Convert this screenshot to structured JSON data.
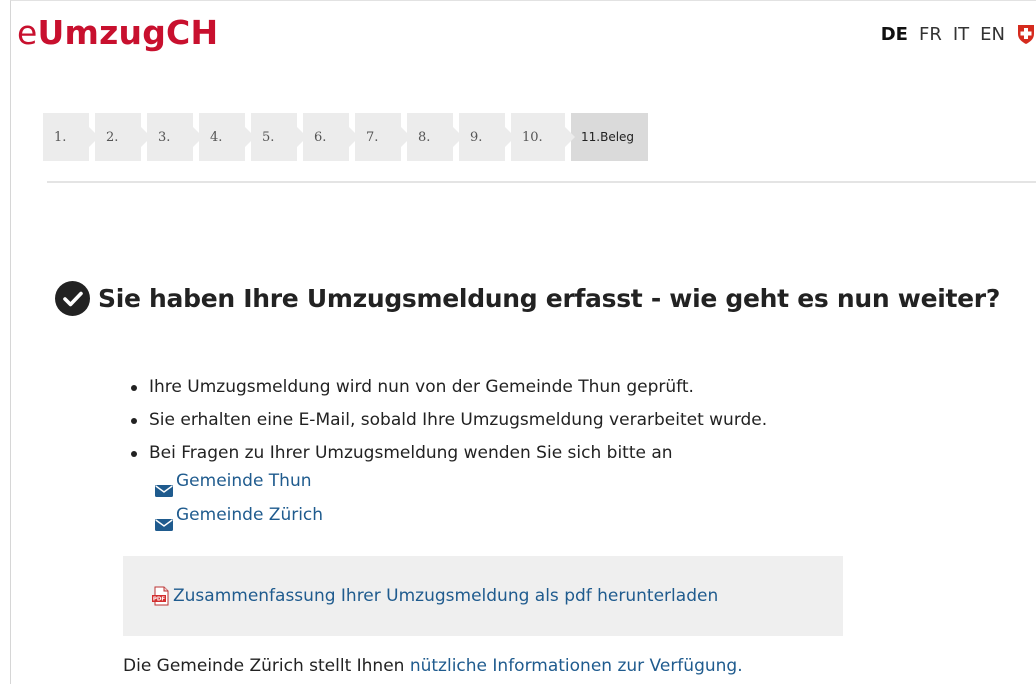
{
  "brand": {
    "prefix": "e",
    "name": "UmzugCH"
  },
  "languages": {
    "de": "DE",
    "fr": "FR",
    "it": "IT",
    "en": "EN",
    "active": "DE",
    "flag_icon": "swiss-cross-icon"
  },
  "steps": [
    {
      "label": "1."
    },
    {
      "label": "2."
    },
    {
      "label": "3."
    },
    {
      "label": "4."
    },
    {
      "label": "5."
    },
    {
      "label": "6."
    },
    {
      "label": "7."
    },
    {
      "label": "8."
    },
    {
      "label": "9."
    },
    {
      "label": "10."
    },
    {
      "label": "11.Beleg",
      "active": true
    }
  ],
  "heading": {
    "icon": "check-circle-icon",
    "text": "Sie haben Ihre Umzugsmeldung erfasst - wie geht es nun weiter?"
  },
  "info": {
    "items": [
      "Ihre Umzugsmeldung wird nun von der Gemeinde Thun geprüft.",
      "Sie erhalten eine E-Mail, sobald Ihre Umzugsmeldung verarbeitet wurde.",
      "Bei Fragen zu Ihrer Umzugsmeldung wenden Sie sich bitte an"
    ],
    "contacts": [
      {
        "icon": "envelope-icon",
        "label": "Gemeinde Thun"
      },
      {
        "icon": "envelope-icon",
        "label": "Gemeinde Zürich"
      }
    ]
  },
  "download": {
    "icon": "pdf-icon",
    "label": "Zusammenfassung Ihrer Umzugsmeldung als pdf herunterladen"
  },
  "footer": {
    "text_before": "Die Gemeinde Zürich stellt Ihnen ",
    "link": "nützliche Informationen zur Verfügung."
  },
  "colors": {
    "brand": "#c8102e",
    "link": "#1f5b8e",
    "step_bg": "#ececec",
    "step_active_bg": "#dadada",
    "box_bg": "#efefef"
  }
}
